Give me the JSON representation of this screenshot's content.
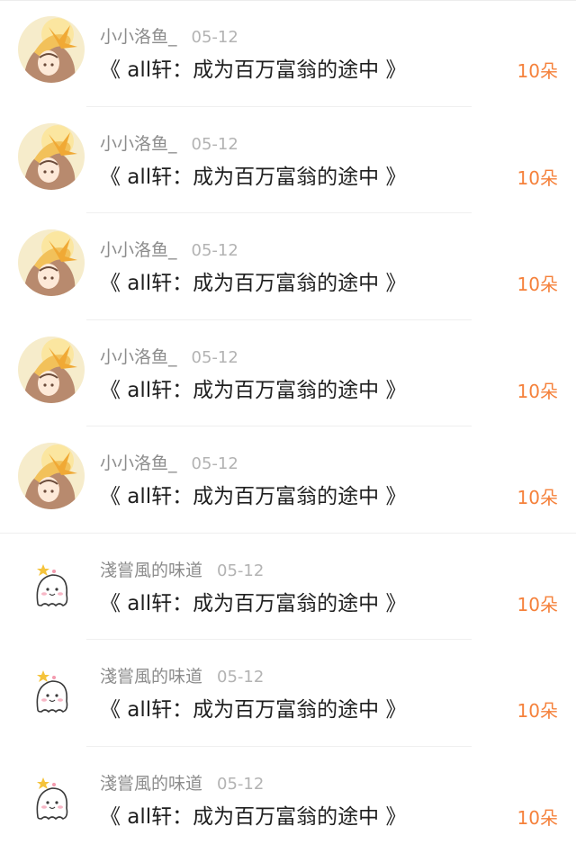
{
  "items": [
    {
      "user": "小小洛鱼_",
      "date": "05-12",
      "title": "《 all轩：成为百万富翁的途中 》",
      "amount": "10朵",
      "avatar": "anime-girl-avatar-icon"
    },
    {
      "user": "小小洛鱼_",
      "date": "05-12",
      "title": "《 all轩：成为百万富翁的途中 》",
      "amount": "10朵",
      "avatar": "anime-girl-avatar-icon"
    },
    {
      "user": "小小洛鱼_",
      "date": "05-12",
      "title": "《 all轩：成为百万富翁的途中 》",
      "amount": "10朵",
      "avatar": "anime-girl-avatar-icon"
    },
    {
      "user": "小小洛鱼_",
      "date": "05-12",
      "title": "《 all轩：成为百万富翁的途中 》",
      "amount": "10朵",
      "avatar": "anime-girl-avatar-icon"
    },
    {
      "user": "小小洛鱼_",
      "date": "05-12",
      "title": "《 all轩：成为百万富翁的途中 》",
      "amount": "10朵",
      "avatar": "anime-girl-avatar-icon"
    },
    {
      "user": "淺嘗風的味道",
      "date": "05-12",
      "title": "《 all轩：成为百万富翁的途中 》",
      "amount": "10朵",
      "avatar": "ghost-avatar-icon"
    },
    {
      "user": "淺嘗風的味道",
      "date": "05-12",
      "title": "《 all轩：成为百万富翁的途中 》",
      "amount": "10朵",
      "avatar": "ghost-avatar-icon"
    },
    {
      "user": "淺嘗風的味道",
      "date": "05-12",
      "title": "《 all轩：成为百万富翁的途中 》",
      "amount": "10朵",
      "avatar": "ghost-avatar-icon"
    }
  ],
  "colors": {
    "amount": "#f5813b",
    "username": "#8c8c8c",
    "date": "#b3b3b3",
    "title": "#1f1f1f"
  }
}
